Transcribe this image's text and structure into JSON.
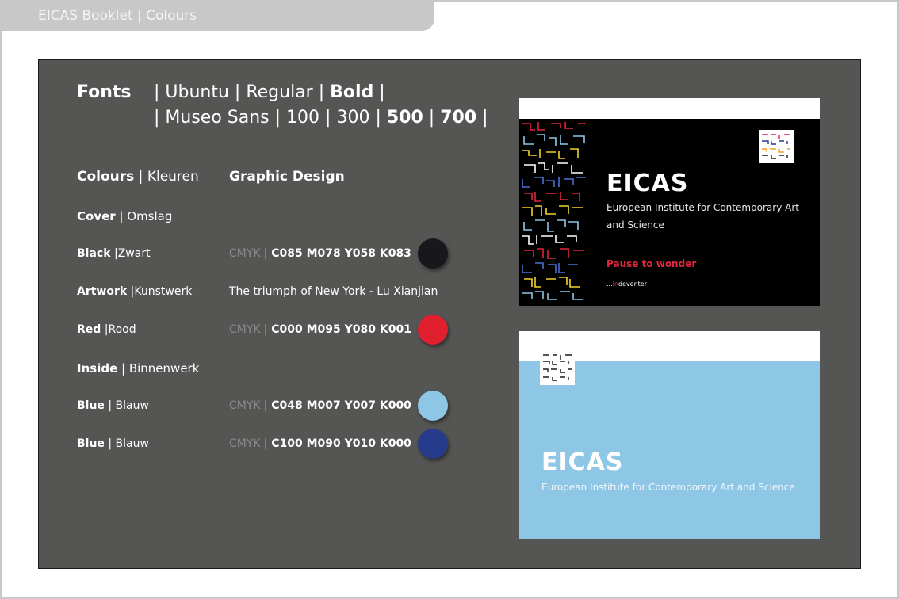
{
  "header": {
    "title": "EICAS Booklet | Colours"
  },
  "fonts": {
    "heading": "Fonts",
    "line1": {
      "sep1": "| ",
      "name": "Ubuntu",
      "sep2": " | ",
      "regular": "Regular",
      "sep3": " | ",
      "bold": "Bold",
      "sep4": " |"
    },
    "line2": {
      "sep1": "| ",
      "name": "Museo Sans",
      "sep2": " | ",
      "w100": "100",
      "sep3": " | ",
      "w300": "300",
      "sep4": " | ",
      "w500": "500",
      "sep5": " | ",
      "w700": "700",
      "sep6": " |"
    }
  },
  "colours": {
    "heading_bold": "Colours",
    "heading_light": " | Kleuren",
    "graphic_design": "Graphic Design",
    "cover": {
      "bold": "Cover",
      "light": " | Omslag"
    },
    "inside": {
      "bold": "Inside",
      "light": " | Binnenwerk"
    },
    "rows": [
      {
        "bold": "Black",
        "light": " |Zwart",
        "cmyk_label": "CMYK",
        "sep": " | ",
        "cmyk": "C085 M078 Y058 K083",
        "swatch": "#18171b"
      },
      {
        "bold": "Artwork",
        "light": " |Kunstwerk",
        "value": "The triumph of New York - Lu Xianjian"
      },
      {
        "bold": "Red",
        "light": " |Rood",
        "cmyk_label": "CMYK",
        "sep": " | ",
        "cmyk": "C000 M095 Y080 K001",
        "swatch": "#e0202f"
      },
      {
        "bold": "Blue",
        "light": " | Blauw",
        "cmyk_label": "CMYK",
        "sep": " | ",
        "cmyk": "C048 M007 Y007 K000",
        "swatch": "#8ec6e6"
      },
      {
        "bold": "Blue",
        "light": " | Blauw",
        "cmyk_label": "CMYK",
        "sep": " | ",
        "cmyk": "C100 M090 Y010 K000",
        "swatch": "#263b8c"
      }
    ]
  },
  "cover_card": {
    "title": "EICAS",
    "subtitle_line1": "European Institute for Contemporary Art",
    "subtitle_line2": "and Science",
    "tagline": "Pause to wonder",
    "footer_pre": "...",
    "footer_red": "in",
    "footer_post": "deventer",
    "logo_text": "EICAS"
  },
  "inside_card": {
    "title": "EICAS",
    "subtitle": "European Institute for Contemporary Art and Science",
    "logo_text": "EICAS"
  },
  "colors": {
    "panel": "#555554",
    "red_accent": "#e0263a",
    "light_blue": "#8ec6e6"
  }
}
